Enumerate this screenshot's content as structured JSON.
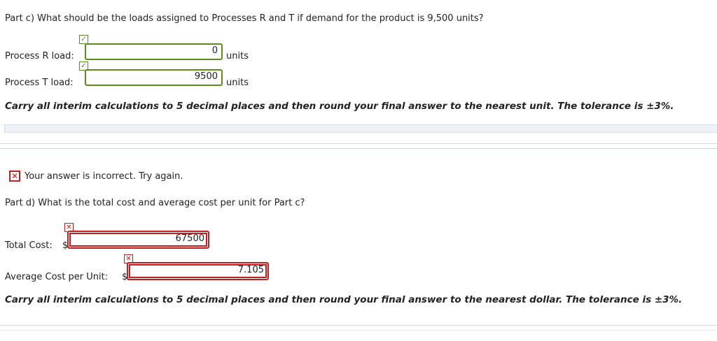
{
  "part_c": {
    "question": "Part c) What should be the loads assigned to Processes R and T if demand for the product is 9,500 units?",
    "process_r": {
      "label": "Process R load:",
      "value": "0",
      "unit": "units"
    },
    "process_t": {
      "label": "Process T load:",
      "value": "9500",
      "unit": "units"
    },
    "note": "Carry all interim calculations to 5 decimal places and then round your final answer to the nearest unit. The tolerance is ±3%."
  },
  "feedback": {
    "message": "Your answer is incorrect.  Try again."
  },
  "part_d": {
    "question": "Part d) What is the total cost and average cost per unit for Part c?",
    "total_cost": {
      "label": "Total Cost:",
      "currency": "$",
      "value": "67500"
    },
    "avg_cost": {
      "label": "Average Cost per Unit:",
      "currency": "$",
      "value": "7.105"
    },
    "note": "Carry all interim calculations to 5 decimal places and then round your final answer to the nearest dollar. The tolerance is ±3%."
  },
  "colors": {
    "correct": "#5b8c1e",
    "incorrect": "#c41e1e"
  },
  "icons": {
    "correct": "check-icon",
    "incorrect": "x-icon"
  }
}
